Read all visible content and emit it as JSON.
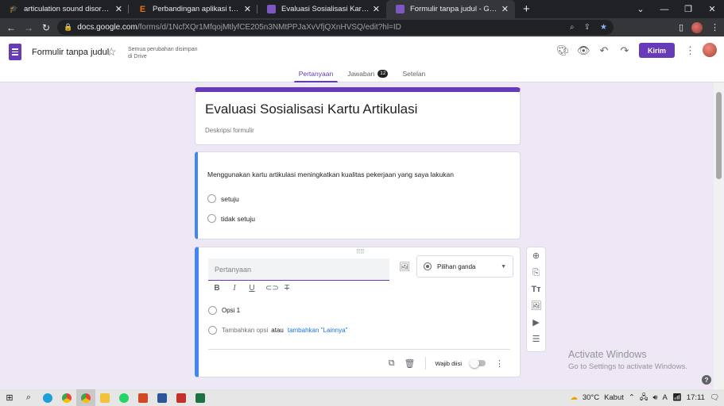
{
  "browser": {
    "tabs": [
      {
        "title": "articulation sound disorders card",
        "favicon": "grad-cap-icon"
      },
      {
        "title": "Perbandingan aplikasi terapi artik",
        "favicon": "e-icon"
      },
      {
        "title": "Evaluasi Sosialisasi Kartu Artikula",
        "favicon": "forms-icon"
      },
      {
        "title": "Formulir tanpa judul - Google Fo",
        "favicon": "forms-icon"
      }
    ],
    "url_host": "docs.google.com",
    "url_path": "/forms/d/1NcfXQr1MfqojMtlyfCE205n3NMtPPJaXvVfjQXnHVSQ/edit?hl=ID"
  },
  "header": {
    "doc_title": "Formulir tanpa judul",
    "save_status": "Semua perubahan disimpan di Drive",
    "send_label": "Kirim",
    "tabs": [
      {
        "label": "Pertanyaan"
      },
      {
        "label": "Jawaban",
        "badge": "12"
      },
      {
        "label": "Setelan"
      }
    ]
  },
  "form": {
    "title": "Evaluasi Sosialisasi Kartu Artikulasi",
    "description_placeholder": "Deskripsi formulir",
    "question1": {
      "text": "Menggunakan kartu artikulasi meningkatkan kualitas pekerjaan yang saya lakukan",
      "options": [
        "setuju",
        "tidak setuju"
      ]
    },
    "editing_question": {
      "placeholder": "Pertanyaan",
      "type": "Pilihan ganda",
      "option1": "Opsi 1",
      "add_option": "Tambahkan opsi",
      "or": "atau",
      "add_other": "tambahkan \"Lainnya\"",
      "required_label": "Wajib diisi"
    }
  },
  "watermark": {
    "line1": "Activate Windows",
    "line2": "Go to Settings to activate Windows."
  },
  "taskbar": {
    "weather": "30°C",
    "weather_desc": "Kabut",
    "time": "17:11"
  },
  "colors": {
    "accent": "#673ab7",
    "active_border": "#4285f4",
    "background": "#ede7f6"
  }
}
